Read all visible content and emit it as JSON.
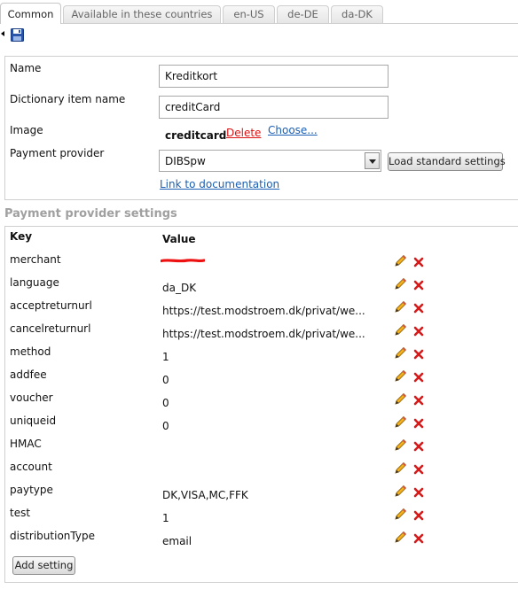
{
  "tabs": [
    {
      "label": "Common",
      "active": true
    },
    {
      "label": "Available in these countries",
      "active": false
    },
    {
      "label": "en-US",
      "active": false
    },
    {
      "label": "de-DE",
      "active": false
    },
    {
      "label": "da-DK",
      "active": false
    }
  ],
  "toolbar": {
    "back_icon": "chevron-left-icon",
    "save_icon": "floppy-disk-icon"
  },
  "form": {
    "name_label": "Name",
    "name_value": "Kreditkort",
    "dict_label": "Dictionary item name",
    "dict_value": "creditCard",
    "image_label": "Image",
    "image_name": "creditcard",
    "delete_label": "Delete",
    "choose_label": "Choose...",
    "provider_label": "Payment provider",
    "provider_value": "DIBSpw",
    "load_button": "Load standard settings",
    "doc_link": "Link to documentation"
  },
  "settings": {
    "title": "Payment provider settings",
    "col_key": "Key",
    "col_value": "Value",
    "rows": [
      {
        "key": "merchant",
        "value": ""
      },
      {
        "key": "language",
        "value": "da_DK"
      },
      {
        "key": "acceptreturnurl",
        "value": "https://test.modstroem.dk/privat/we..."
      },
      {
        "key": "cancelreturnurl",
        "value": "https://test.modstroem.dk/privat/we..."
      },
      {
        "key": "method",
        "value": "1"
      },
      {
        "key": "addfee",
        "value": "0"
      },
      {
        "key": "voucher",
        "value": "0"
      },
      {
        "key": "uniqueid",
        "value": "0"
      },
      {
        "key": "HMAC",
        "value": ""
      },
      {
        "key": "account",
        "value": ""
      },
      {
        "key": "paytype",
        "value": "DK,VISA,MC,FFK"
      },
      {
        "key": "test",
        "value": "1"
      },
      {
        "key": "distributionType",
        "value": "email"
      }
    ],
    "add_button": "Add setting"
  },
  "colors": {
    "delete_link": "#dd1111",
    "link": "#1a5fb4",
    "section_title": "#a0a0a0",
    "redaction": "#ee1111"
  }
}
